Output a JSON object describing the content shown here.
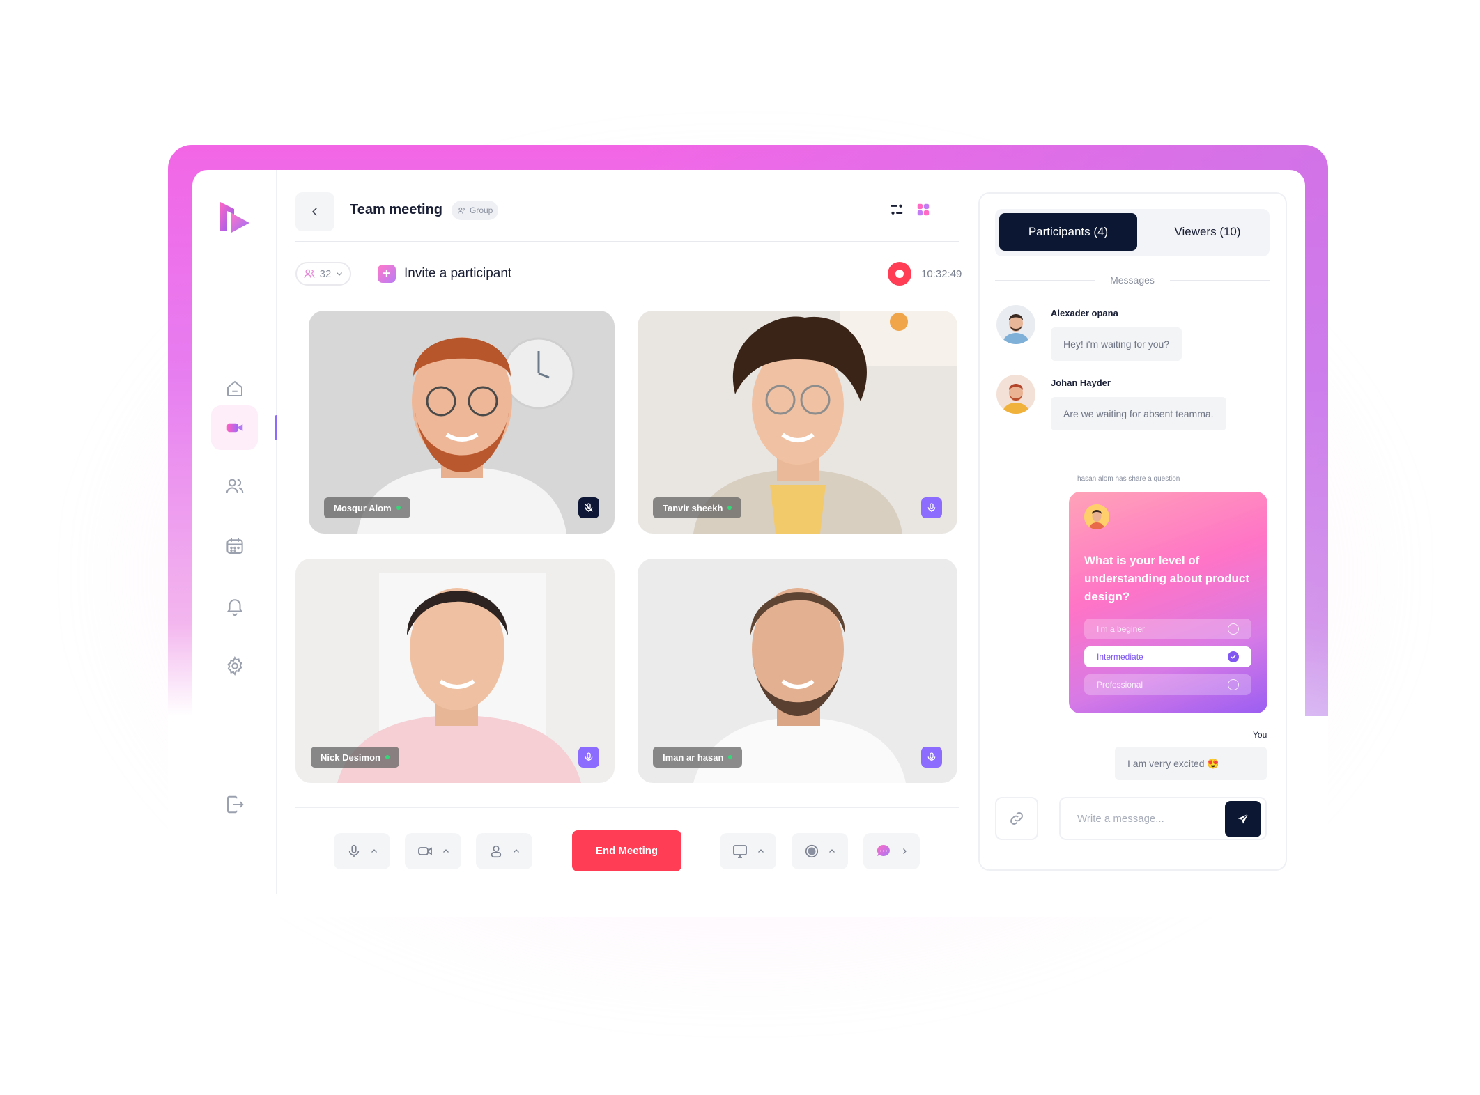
{
  "meeting": {
    "title": "Team meeting",
    "badge": "Group",
    "participant_count": "32",
    "invite_label": "Invite  a participant",
    "elapsed_time": "10:32:49"
  },
  "tiles": [
    {
      "name": "Mosqur Alom",
      "mic": "muted"
    },
    {
      "name": "Tanvir sheekh",
      "mic": "on"
    },
    {
      "name": "Nick Desimon",
      "mic": "on"
    },
    {
      "name": "Iman ar hasan",
      "mic": "on"
    }
  ],
  "controls": {
    "end_label": "End Meeting"
  },
  "panel": {
    "tab_participants": "Participants (4)",
    "tab_viewers": "Viewers (10)",
    "messages_label": "Messages",
    "messages": [
      {
        "sender": "Alexader opana",
        "text": "Hey! i'm waiting for you?"
      },
      {
        "sender": "Johan Hayder",
        "text": "Are we waiting for absent teamma."
      }
    ],
    "shared_note": "hasan alom has share a question",
    "quiz": {
      "question": "What is your level of understanding about product design?",
      "options": [
        "I'm a beginer",
        "Intermediate",
        "Professional"
      ],
      "selected": "Intermediate"
    },
    "you_label": "You",
    "my_message": "I am verry excited 😍",
    "composer_placeholder": "Write a message..."
  },
  "colors": {
    "accent": "#8c6bff",
    "danger": "#ff3d55",
    "dark": "#0b1733",
    "frame_gradient": [
      "#f266e6",
      "#b87ce8"
    ]
  }
}
